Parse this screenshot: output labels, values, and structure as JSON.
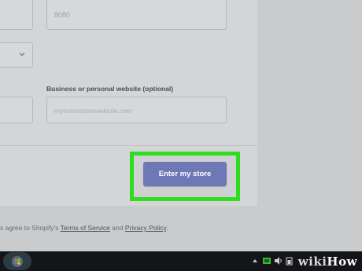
{
  "form": {
    "zip_value": "8080",
    "website_label": "Business or personal website (optional)",
    "website_placeholder": "myhomestorewebsite.com"
  },
  "actions": {
    "enter_store_label": "Enter my store",
    "highlight_color": "#2fdc1f"
  },
  "agreement": {
    "prefix": "s agree to Shopify's",
    "terms": "Terms of Service",
    "and": "and",
    "privacy": "Privacy Policy",
    "suffix": "."
  },
  "taskbar": {
    "icons": [
      "windows-start-icon",
      "network-icon",
      "volume-icon",
      "battery-icon"
    ]
  },
  "watermark": {
    "prefix": "wiki",
    "suffix": "How"
  }
}
